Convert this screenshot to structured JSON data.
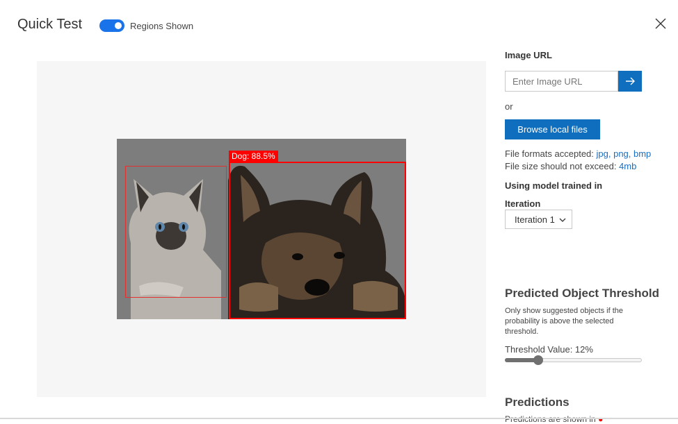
{
  "header": {
    "title": "Quick Test",
    "toggle_label": "Regions Shown",
    "toggle_on": true
  },
  "preview": {
    "region_tag": "Dog: 88.5%",
    "regions_color": "#ff0000"
  },
  "sidebar": {
    "image_url_label": "Image URL",
    "image_url_placeholder": "Enter Image URL",
    "image_url_value": "",
    "or_text": "or",
    "browse_label": "Browse local files",
    "formats_text": "File formats accepted:",
    "formats_links": "jpg, png, bmp",
    "size_text": "File size should not exceed:",
    "size_link": "4mb",
    "model_label": "Using model trained in",
    "iteration_label": "Iteration",
    "iteration_selected": "Iteration 1"
  },
  "threshold": {
    "heading": "Predicted Object Threshold",
    "description": "Only show suggested objects if the probability is above the selected threshold.",
    "value_label": "Threshold Value: 12%",
    "value_fraction": 0.12
  },
  "predictions": {
    "heading": "Predictions",
    "subtext": "Predictions are shown in"
  },
  "colors": {
    "accent": "#106ebe",
    "toggle": "#1a73e8",
    "link": "#1a6fc0"
  }
}
